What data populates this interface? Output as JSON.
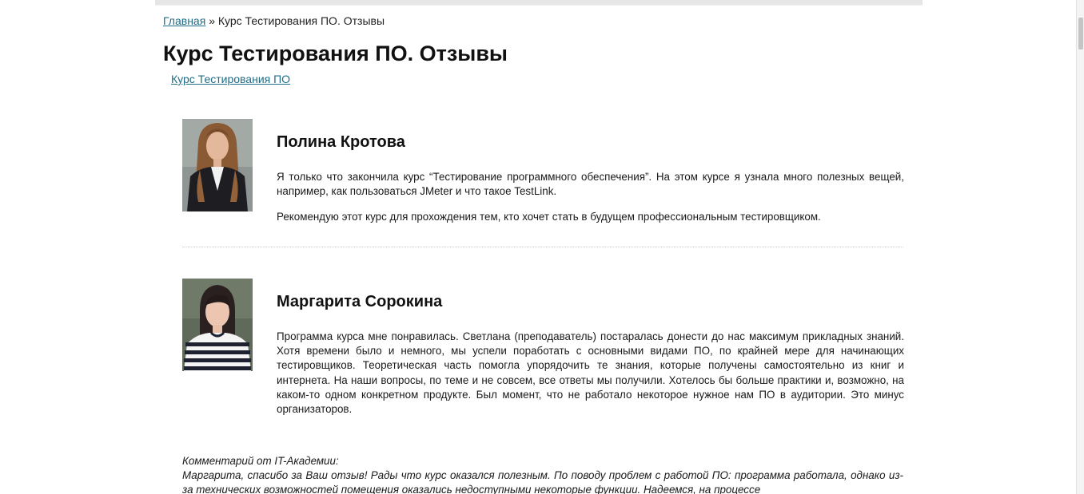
{
  "breadcrumb": {
    "home_label": "Главная",
    "separator": "»",
    "current": "Курс Тестирования ПО. Отзывы"
  },
  "page_title": "Курс Тестирования ПО. Отзывы",
  "course_link": "Курс Тестирования ПО",
  "reviews": [
    {
      "name": "Полина Кротова",
      "photo": "portrait-woman-long-hair",
      "paragraphs": [
        "Я только что закончила курс “Тестирование программного обеспечения”. На этом курсе я узнала много полезных вещей, например, как пользоваться JMeter и что такое TestLink.",
        "Рекомендую этот курс для прохождения тем, кто хочет стать в будущем профессиональным тестировщиком."
      ]
    },
    {
      "name": "Маргарита Сорокина",
      "photo": "portrait-woman-striped-top",
      "paragraphs": [
        "Программа курса мне понравилась. Светлана (преподаватель) постаралась донести до нас максимум прикладных знаний. Хотя времени было и немного, мы успели поработать с основными видами ПО, по крайней мере для начинающих тестировщиков. Теоретическая часть помогла упорядочить те знания, которые получены самостоятельно из книг и интернета. На наши вопросы, по теме и не совсем, все ответы мы получили. Хотелось бы больше практики и, возможно, на каком-то одном конкретном продукте. Был момент, что не работало некоторое нужное нам ПО в аудитории. Это минус организаторов."
      ]
    }
  ],
  "academy_comment": {
    "title": "Комментарий от IT-Академии:",
    "text": "Маргарита, спасибо за Ваш отзыв! Рады что курс оказался полезным. По поводу проблем с работой ПО: программа работала, однако из-за технических возможностей помещения оказались недоступными некоторые функции. Надеемся, на процессе"
  },
  "colors": {
    "link": "#1f6c86",
    "text": "#111111",
    "divider": "#cfcfcf"
  }
}
